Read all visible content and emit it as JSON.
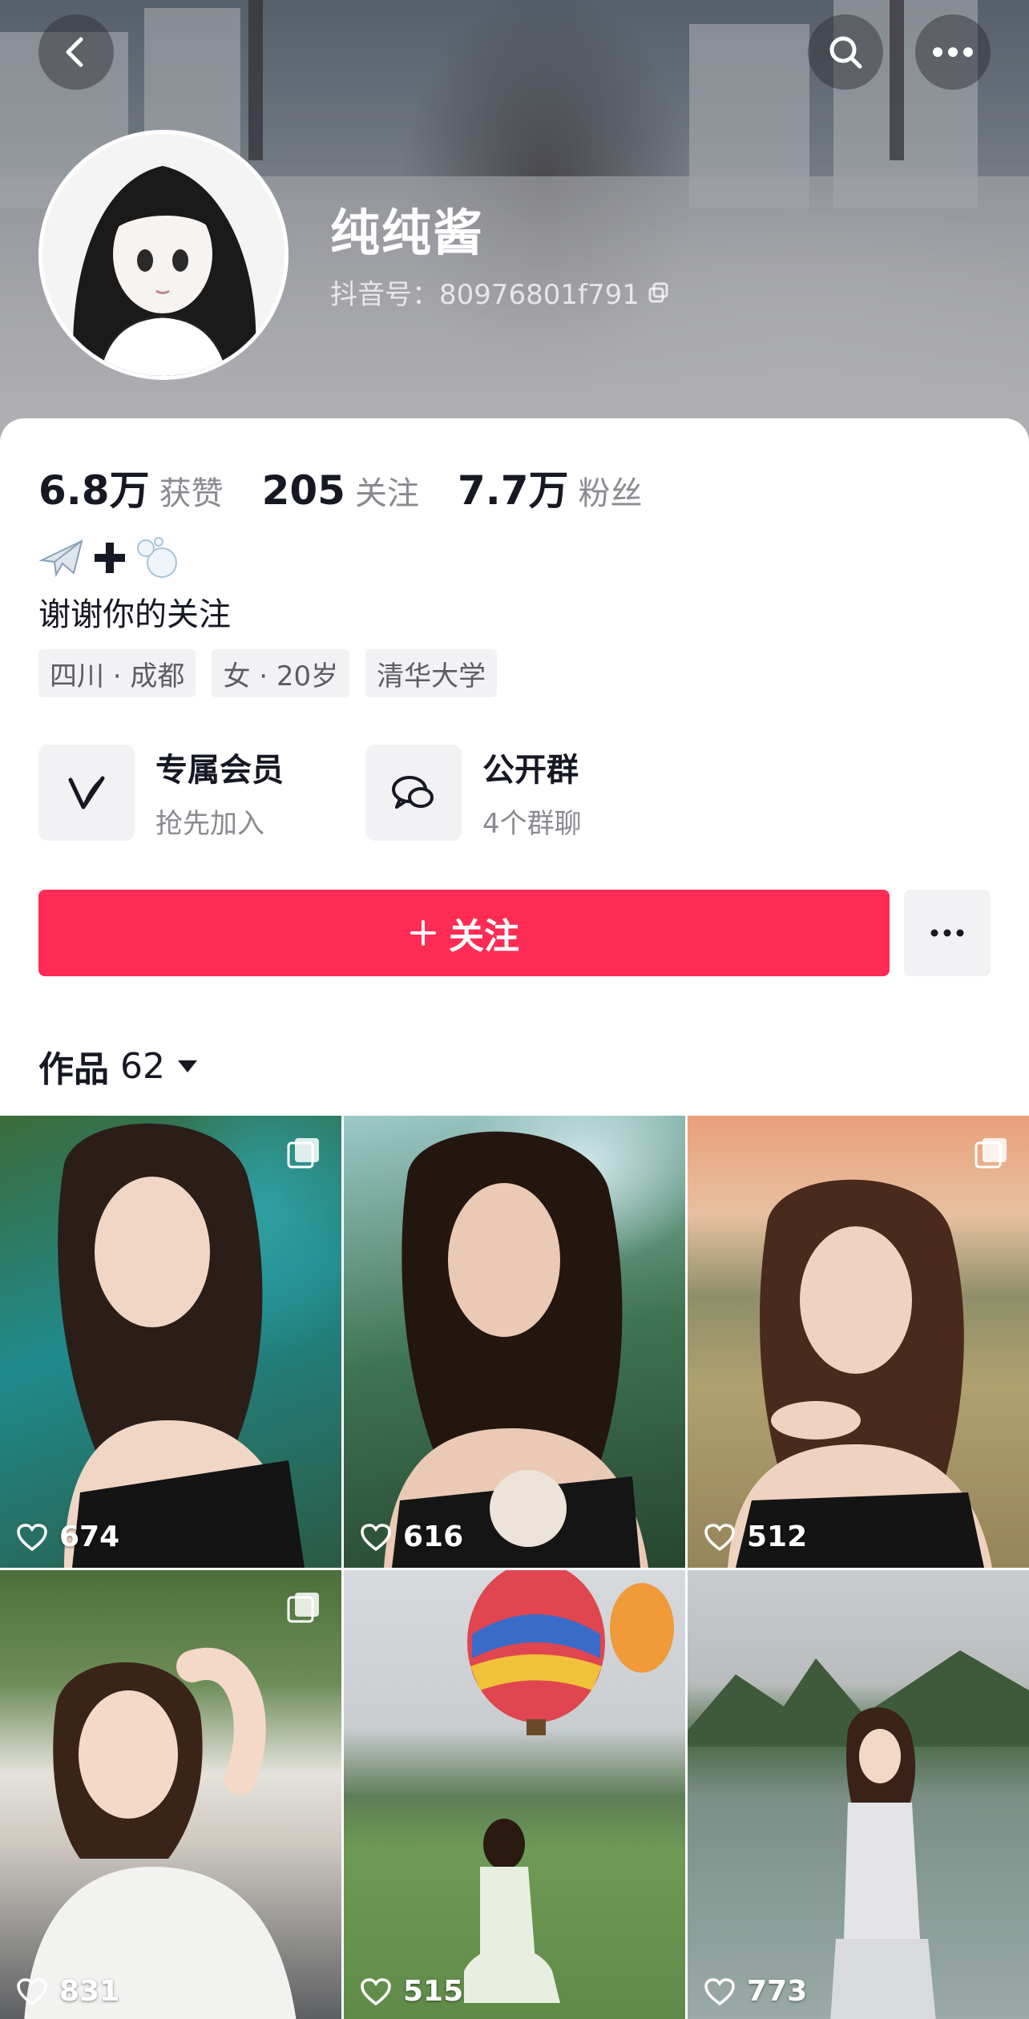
{
  "profile": {
    "nickname": "纯纯酱",
    "douyin_id": "抖音号：80976801f791",
    "stats": [
      {
        "value": "6.8万",
        "label": "获赞"
      },
      {
        "value": "205",
        "label": "关注"
      },
      {
        "value": "7.7万",
        "label": "粉丝"
      }
    ],
    "bio_emoji": "✈️➕🫧",
    "bio": "谢谢你的关注",
    "tags": [
      "四川 · 成都",
      "女 · 20岁",
      "清华大学"
    ]
  },
  "header": {
    "back_icon": "back-icon",
    "search_icon": "search-icon",
    "more_icon": "more-icon"
  },
  "features": [
    {
      "title": "专属会员",
      "subtitle": "抢先加入",
      "icon": "vip-v-icon"
    },
    {
      "title": "公开群",
      "subtitle": "4个群聊",
      "icon": "group-chat-icon"
    }
  ],
  "actions": {
    "follow_label": "关注"
  },
  "works": {
    "label": "作品",
    "count": "62"
  },
  "videos": [
    {
      "likes": "674",
      "multi": true
    },
    {
      "likes": "616",
      "multi": false
    },
    {
      "likes": "512",
      "multi": true
    },
    {
      "likes": "831",
      "multi": true
    },
    {
      "likes": "515",
      "multi": false
    },
    {
      "likes": "773",
      "multi": false
    }
  ],
  "colors": {
    "accent": "#fe2c55",
    "text_primary": "#161823",
    "text_secondary": "#8a8b91",
    "chip_bg": "#f2f2f4"
  }
}
